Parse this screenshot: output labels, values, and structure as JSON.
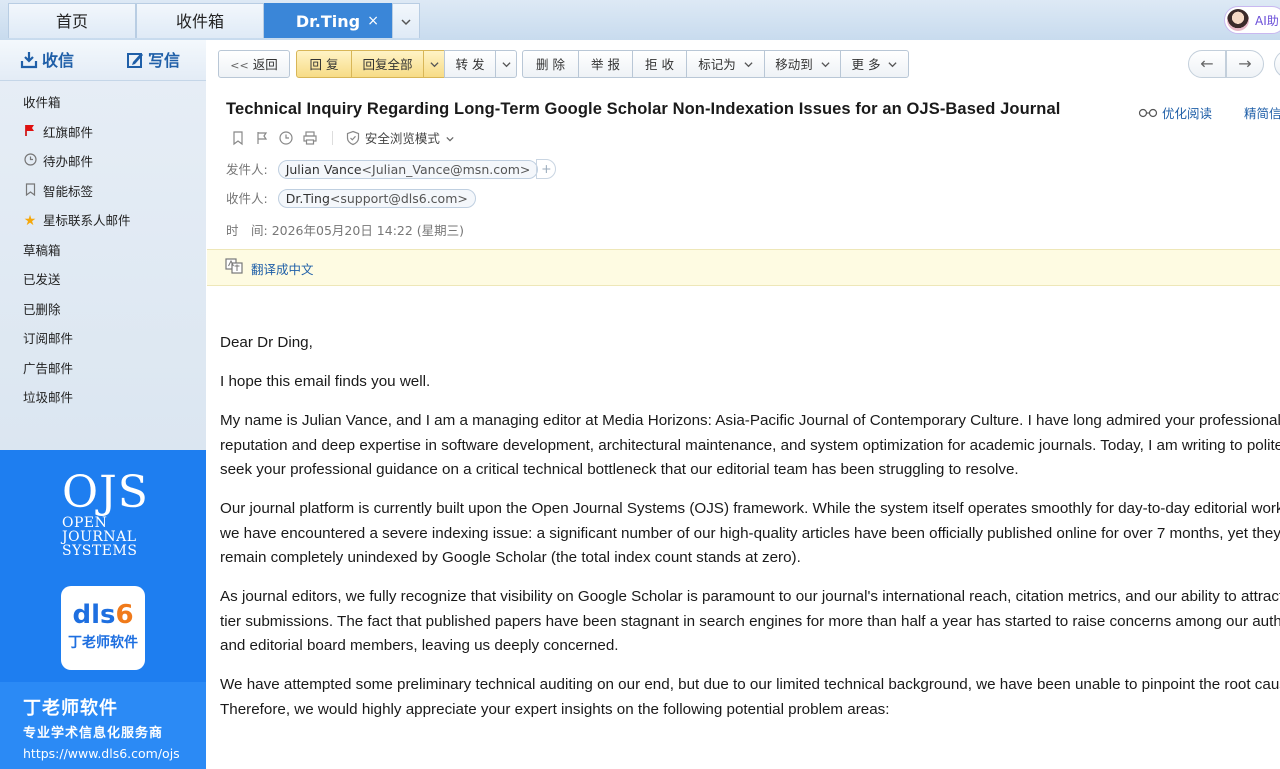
{
  "tabs": [
    {
      "label": "首页"
    },
    {
      "label": "收件箱"
    },
    {
      "label": "Dr.Ting",
      "active": true,
      "close": "×"
    }
  ],
  "tab_more_icon": "chevron-down-icon",
  "ai_button": {
    "label": "AI助"
  },
  "sidebar": {
    "receive_label": "收信",
    "write_label": "写信",
    "folders": [
      {
        "label": "收件箱",
        "icon": ""
      },
      {
        "label": "红旗邮件",
        "icon": "red-flag-icon"
      },
      {
        "label": "待办邮件",
        "icon": "clock-icon"
      },
      {
        "label": "智能标签",
        "icon": "bookmark-icon"
      },
      {
        "label": "星标联系人邮件",
        "icon": "star-icon"
      },
      {
        "label": "草稿箱",
        "icon": ""
      },
      {
        "label": "已发送",
        "icon": ""
      },
      {
        "label": "已删除",
        "icon": ""
      },
      {
        "label": "订阅邮件",
        "icon": ""
      },
      {
        "label": "广告邮件",
        "icon": ""
      },
      {
        "label": "垃圾邮件",
        "icon": ""
      }
    ],
    "ad": {
      "logo_big": "OJS",
      "logo_lines": [
        "OPEN",
        "JOURNAL",
        "SYSTEMS"
      ],
      "card_word_a": "dls",
      "card_word_b": "6",
      "card_sub": "丁老师软件",
      "title": "丁老师软件",
      "slogan": "专业学术信息化服务商",
      "url": "https://www.dls6.com/ojs"
    }
  },
  "toolbar": {
    "back": "返回",
    "reply": "回 复",
    "reply_all": "回复全部",
    "forward": "转 发",
    "delete": "删 除",
    "report": "举 报",
    "reject": "拒 收",
    "mark_as": "标记为",
    "move_to": "移动到",
    "more": "更 多"
  },
  "mail": {
    "subject": "Technical Inquiry Regarding Long-Term Google Scholar Non-Indexation Issues for an OJS-Based Journal",
    "optimize_read": "优化阅读",
    "simplified_info": "精简信息",
    "safe_mode": "安全浏览模式",
    "from_label": "发件人:",
    "from_name": "Julian Vance",
    "from_addr": "<Julian_Vance@msn.com>",
    "to_label": "收件人:",
    "to_name": "Dr.Ting",
    "to_addr": "<support@dls6.com>",
    "time_label": "时　间:",
    "time_value": "2026年05月20日 14:22 (星期三)",
    "translate": "翻译成中文",
    "body": [
      [
        "Dear Dr Ding,"
      ],
      [
        "I hope this email finds you well."
      ],
      [
        "My name is Julian Vance, and I am a managing editor at Media Horizons: Asia-Pacific Journal of Contemporary Culture. I have long admired your professional",
        "reputation and deep expertise in software development, architectural maintenance, and system optimization for academic journals. Today, I am writing to politely",
        "seek your professional guidance on a critical technical bottleneck that our editorial team has been struggling to resolve."
      ],
      [
        "Our journal platform is currently built upon the Open Journal Systems (OJS) framework. While the system itself operates smoothly for day-to-day editorial workflows,",
        "we have encountered a severe indexing issue: a significant number of our high-quality articles have been officially published online for over 7 months, yet they",
        "remain completely unindexed by Google Scholar (the total index count stands at zero)."
      ],
      [
        "As journal editors, we fully recognize that visibility on Google Scholar is paramount to our journal's international reach, citation metrics, and our ability to attract top-",
        "tier submissions. The fact that published papers have been stagnant in search engines for more than half a year has started to raise concerns among our authors",
        "and editorial board members, leaving us deeply concerned."
      ],
      [
        "We have attempted some preliminary technical auditing on our end, but due to our limited technical background, we have been unable to pinpoint the root cause.",
        "Therefore, we would highly appreciate your expert insights on the following potential problem areas:"
      ]
    ]
  }
}
